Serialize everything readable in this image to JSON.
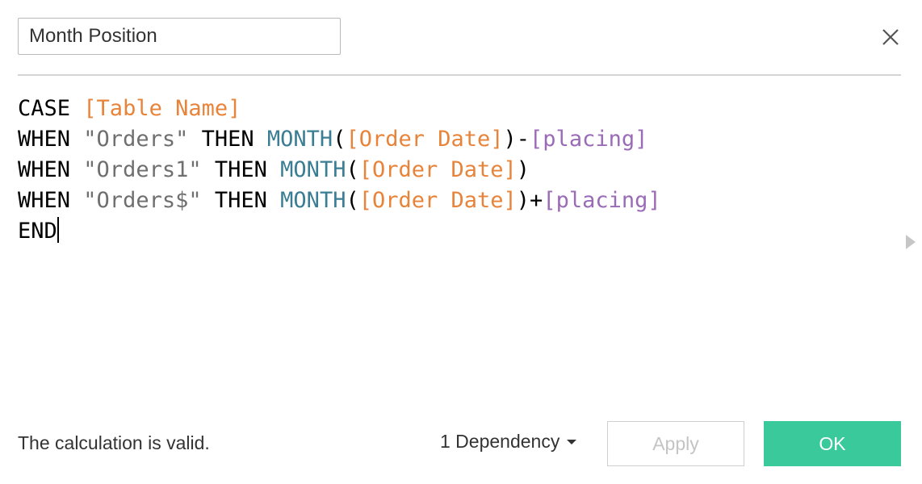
{
  "header": {
    "calc_name": "Month Position",
    "close_icon": "close-icon"
  },
  "editor": {
    "line1": {
      "kw1": "CASE",
      "field1": "[Table Name]"
    },
    "line2": {
      "kw1": "WHEN",
      "str1": "\"Orders\"",
      "kw2": "THEN",
      "fn1": "MONTH",
      "open": "(",
      "field1": "[Order Date]",
      "close_op": ")-",
      "param1": "[placing]"
    },
    "line3": {
      "kw1": "WHEN",
      "str1": "\"Orders1\"",
      "kw2": "THEN",
      "fn1": "MONTH",
      "open": "(",
      "field1": "[Order Date]",
      "close": ")"
    },
    "line4": {
      "kw1": "WHEN",
      "str1": "\"Orders$\"",
      "kw2": "THEN",
      "fn1": "MONTH",
      "open": "(",
      "field1": "[Order Date]",
      "close_op": ")+",
      "param1": "[placing]"
    },
    "line5": {
      "kw1": "END"
    }
  },
  "footer": {
    "status": "The calculation is valid.",
    "dependency": "1 Dependency",
    "apply": "Apply",
    "ok": "OK"
  },
  "colors": {
    "keyword": "#000000",
    "string": "#6f6f6f",
    "function": "#3b7d92",
    "field": "#e8833a",
    "parameter": "#9a6bb7",
    "ok_button": "#39c99a"
  }
}
